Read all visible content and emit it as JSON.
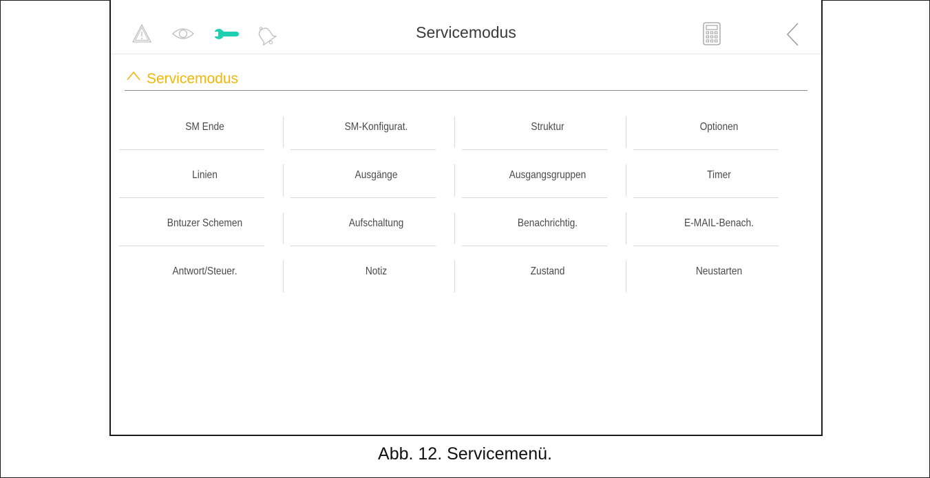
{
  "topbar": {
    "title": "Servicemodus",
    "icons": {
      "alarm": "warning-triangle-icon",
      "view": "eye-icon",
      "service": "wrench-icon",
      "notifications": "bell-icon",
      "keypad": "keypad-icon",
      "back": "chevron-left-icon"
    }
  },
  "section": {
    "label": "Servicemodus",
    "expanded": true
  },
  "menu": {
    "items": [
      "SM Ende",
      "SM-Konfigurat.",
      "Struktur",
      "Optionen",
      "Linien",
      "Ausgänge",
      "Ausgangsgruppen",
      "Timer",
      "Bntuzer Schemen",
      "Aufschaltung",
      "Benachrichtig.",
      "E-MAIL-Benach.",
      "Antwort/Steuer.",
      "Notiz",
      "Zustand",
      "Neustarten"
    ]
  },
  "caption": "Abb. 12. Servicemenü.",
  "colors": {
    "accent_yellow": "#f2b705",
    "service_active_teal": "#1ecfb1",
    "inactive_icon": "#bdbdbd"
  }
}
